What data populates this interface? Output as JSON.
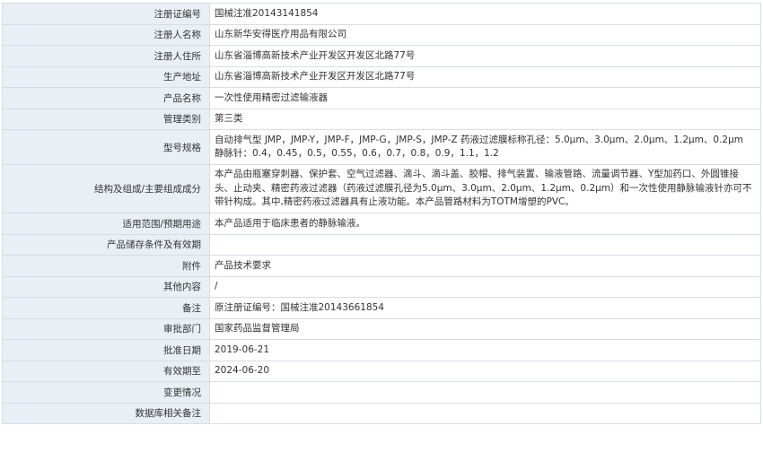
{
  "rows": [
    {
      "label": "注册证编号",
      "value": "国械注准20143141854"
    },
    {
      "label": "注册人名称",
      "value": "山东新华安得医疗用品有限公司"
    },
    {
      "label": "注册人住所",
      "value": "山东省淄博高新技术产业开发区开发区北路77号"
    },
    {
      "label": "生产地址",
      "value": "山东省淄博高新技术产业开发区开发区北路77号"
    },
    {
      "label": "产品名称",
      "value": "一次性使用精密过滤输液器"
    },
    {
      "label": "管理类别",
      "value": "第三类"
    },
    {
      "label": "型号规格",
      "value": "自动排气型 JMP，JMP-Y，JMP-F，JMP-G，JMP-S，JMP-Z 药液过滤膜标称孔径：5.0μm、3.0μm、2.0μm、1.2μm、0.2μm 静脉针：0.4，0.45，0.5，0.55，0.6，0.7，0.8，0.9，1.1，1.2"
    },
    {
      "label": "结构及组成/主要组成成分",
      "value": "本产品由瓶塞穿刺器、保护套、空气过滤器、滴斗、滴斗盖、胶帽、排气装置、输液管路、流量调节器、Y型加药口、外圆锥接头、止动夹、精密药液过滤器（药液过滤膜孔径为5.0μm、3.0μm、2.0μm、1.2μm、0.2μm）和一次性使用静脉输液针亦可不带针构成。其中,精密药液过滤器具有止液功能。本产品管路材料为TOTM增塑的PVC。"
    },
    {
      "label": "适用范围/预期用途",
      "value": "本产品适用于临床患者的静脉输液。"
    },
    {
      "label": "产品储存条件及有效期",
      "value": ""
    },
    {
      "label": "附件",
      "value": "产品技术要求"
    },
    {
      "label": "其他内容",
      "value": "/"
    },
    {
      "label": "备注",
      "value": "原注册证编号：国械注准20143661854"
    },
    {
      "label": "审批部门",
      "value": "国家药品监督管理局"
    },
    {
      "label": "批准日期",
      "value": "2019-06-21"
    },
    {
      "label": "有效期至",
      "value": "2024-06-20"
    },
    {
      "label": "变更情况",
      "value": ""
    },
    {
      "label": "数据库相关备注",
      "value": ""
    }
  ]
}
